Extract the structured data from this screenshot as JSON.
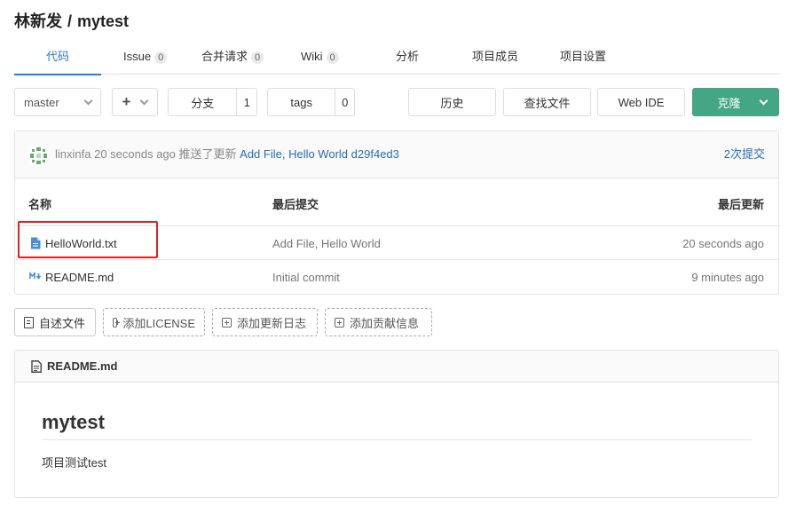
{
  "header": {
    "owner": "林新发",
    "separator": "/",
    "repo": "mytest"
  },
  "tabs": [
    {
      "label": "代码",
      "count": null,
      "active": true
    },
    {
      "label": "Issue",
      "count": "0"
    },
    {
      "label": "合并请求",
      "count": "0"
    },
    {
      "label": "Wiki",
      "count": "0"
    },
    {
      "label": "分析",
      "count": null
    },
    {
      "label": "项目成员",
      "count": null
    },
    {
      "label": "项目设置",
      "count": null
    }
  ],
  "toolbar": {
    "branch": "master",
    "add": "+",
    "branches_label": "分支",
    "branches_count": "1",
    "tags_label": "tags",
    "tags_count": "0",
    "history": "历史",
    "find_file": "查找文件",
    "web_ide": "Web IDE",
    "clone": "克隆"
  },
  "last_commit": {
    "author": "linxinfa",
    "time": "20 seconds ago",
    "action": "推送了更新",
    "message": "Add File, Hello World",
    "sha": "d29f4ed3",
    "commits_link": "2次提交"
  },
  "file_table": {
    "headers": {
      "name": "名称",
      "last_commit": "最后提交",
      "last_update": "最后更新"
    },
    "rows": [
      {
        "icon": "file-text-icon",
        "name": "HelloWorld.txt",
        "commit": "Add File, Hello World",
        "time": "20 seconds ago"
      },
      {
        "icon": "markdown-icon",
        "name": "README.md",
        "commit": "Initial commit",
        "time": "9 minutes ago"
      }
    ]
  },
  "actions": {
    "readme": "自述文件",
    "license": "添加LICENSE",
    "changelog": "添加更新日志",
    "contributing": "添加贡献信息"
  },
  "readme": {
    "filename": "README.md",
    "heading": "mytest",
    "body": "项目测试test"
  },
  "colors": {
    "accent": "#2b7bd0",
    "clone": "#44a685",
    "link": "#2b6cb0",
    "highlight": "#e02020"
  }
}
